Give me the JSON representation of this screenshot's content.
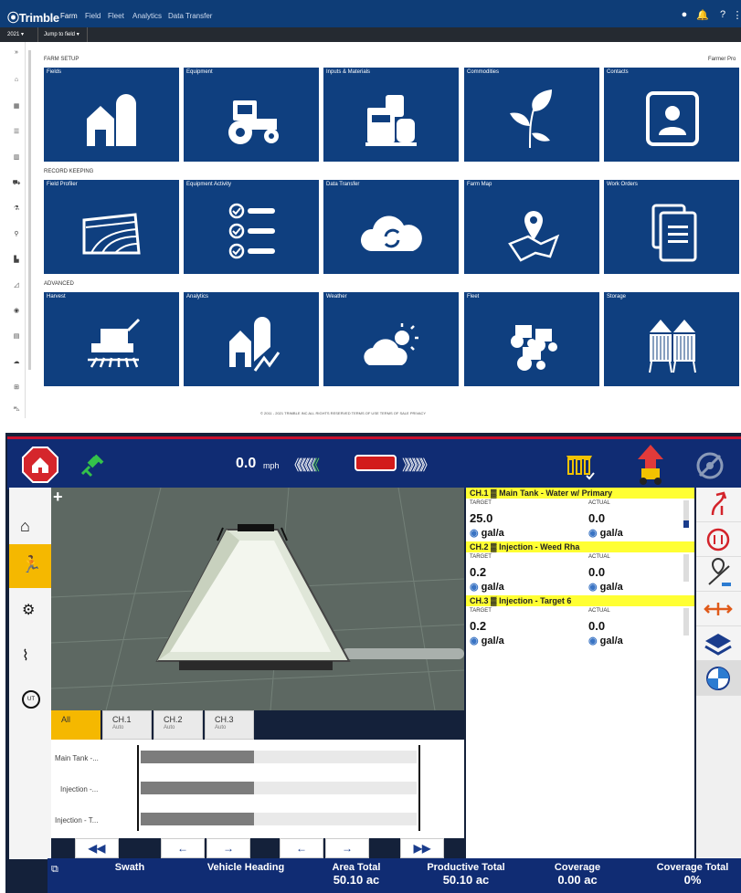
{
  "top": {
    "brand": "Trimble",
    "nav": [
      "Farm",
      "Field",
      "Fleet",
      "Analytics",
      "Data Transfer"
    ],
    "year_select": "2021",
    "jump_select": "Jump to field",
    "farm_pro": "Farmer Pro",
    "sections": [
      "FARM SETUP",
      "RECORD KEEPING",
      "ADVANCED"
    ],
    "tiles": [
      [
        "Fields",
        "Equipment",
        "Inputs & Materials",
        "Commodities",
        "Contacts"
      ],
      [
        "Field Profiler",
        "Equipment Activity",
        "Data Transfer",
        "Farm Map",
        "Work Orders"
      ],
      [
        "Harvest",
        "Analytics",
        "Weather",
        "Fleet",
        "Storage"
      ]
    ],
    "footer": "© 2011 - 2021 TRIMBLE INC ALL RIGHTS RESERVED   TERMS OF USE   TERMS OF SALE   PRIVACY"
  },
  "bottom": {
    "speed_value": "0.0",
    "speed_unit": "mph",
    "channels": [
      {
        "head": "CH.1 ▓ Main Tank - Water w/ Primary",
        "target_label": "TARGET",
        "actual_label": "ACTUAL",
        "target": "25.0",
        "actual": "0.0",
        "unit": "gal/a"
      },
      {
        "head": "CH.2 ▓ Injection - Weed Rha",
        "target_label": "TARGET",
        "actual_label": "ACTUAL",
        "target": "0.2",
        "actual": "0.0",
        "unit": "gal/a"
      },
      {
        "head": "CH.3 ▓ Injection - Target 6",
        "target_label": "TARGET",
        "actual_label": "ACTUAL",
        "target": "0.2",
        "actual": "0.0",
        "unit": "gal/a"
      }
    ],
    "tabs": [
      {
        "label": "All",
        "sub": ""
      },
      {
        "label": "CH.1",
        "sub": "Auto"
      },
      {
        "label": "CH.2",
        "sub": "Auto"
      },
      {
        "label": "CH.3",
        "sub": "Auto"
      }
    ],
    "rows": [
      "Main Tank -...",
      "Injection -...",
      "Injection - T..."
    ],
    "nav_buttons": [
      "◀◀",
      "←",
      "→",
      "←",
      "→",
      "▶▶"
    ],
    "status": [
      {
        "k": "Swath",
        "v": ""
      },
      {
        "k": "Vehicle Heading",
        "v": ""
      },
      {
        "k": "Area Total",
        "v": "50.10 ac"
      },
      {
        "k": "Productive Total",
        "v": "50.10 ac"
      },
      {
        "k": "Coverage",
        "v": "0.00 ac"
      },
      {
        "k": "Coverage Total",
        "v": "0%"
      }
    ]
  }
}
